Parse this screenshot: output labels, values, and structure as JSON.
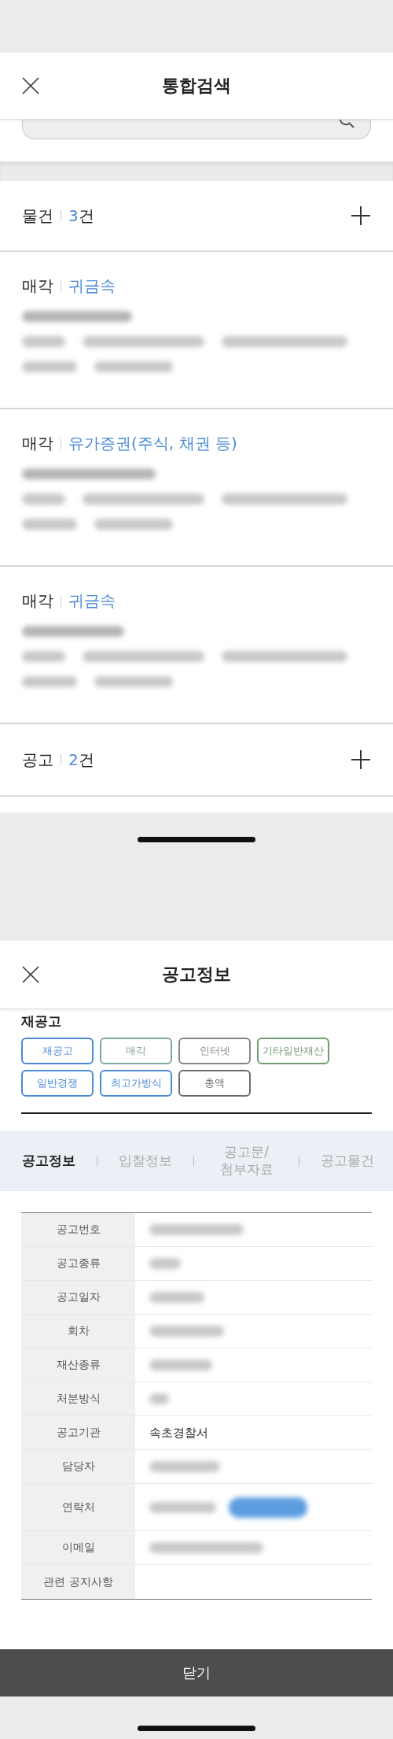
{
  "search_screen": {
    "title": "통합검색",
    "sections": [
      {
        "label": "물건",
        "count": "3",
        "unit": "건",
        "cards": [
          {
            "type": "매각",
            "category": "귀금속"
          },
          {
            "type": "매각",
            "category": "유가증권(주식, 채권 등)"
          },
          {
            "type": "매각",
            "category": "귀금속"
          }
        ]
      },
      {
        "label": "공고",
        "count": "2",
        "unit": "건"
      }
    ]
  },
  "notice_screen": {
    "title": "공고정보",
    "heading": "재공고",
    "tags": [
      {
        "label": "재공고",
        "color": "#4a8ad6"
      },
      {
        "label": "매각",
        "color": "#7fa7a2"
      },
      {
        "label": "인터넷",
        "color": "#8a8686"
      },
      {
        "label": "기타일반재산",
        "color": "#6e9e6e"
      },
      {
        "label": "일반경쟁",
        "color": "#4a8ad6"
      },
      {
        "label": "최고가방식",
        "color": "#4a8ad6"
      },
      {
        "label": "총액",
        "color": "#6e6a6a"
      }
    ],
    "tabs": [
      {
        "label": "공고정보",
        "selected": true
      },
      {
        "label": "입찰정보",
        "selected": false
      },
      {
        "label": "공고문/ 첨부자료",
        "selected": false
      },
      {
        "label": "공고물건",
        "selected": false
      }
    ],
    "rows": [
      {
        "label": "공고번호",
        "kind": "blurred"
      },
      {
        "label": "공고종류",
        "kind": "blurred"
      },
      {
        "label": "공고일자",
        "kind": "blurred"
      },
      {
        "label": "회차",
        "kind": "blurred"
      },
      {
        "label": "재산종류",
        "kind": "blurred"
      },
      {
        "label": "처분방식",
        "kind": "blurred"
      },
      {
        "label": "공고기관",
        "kind": "text",
        "value": "속초경찰서"
      },
      {
        "label": "담당자",
        "kind": "blurred"
      },
      {
        "label": "연락처",
        "kind": "blurred_button"
      },
      {
        "label": "이메일",
        "kind": "blurred"
      },
      {
        "label": "관련 공지사항",
        "kind": "empty"
      }
    ],
    "close_button": "닫기"
  }
}
